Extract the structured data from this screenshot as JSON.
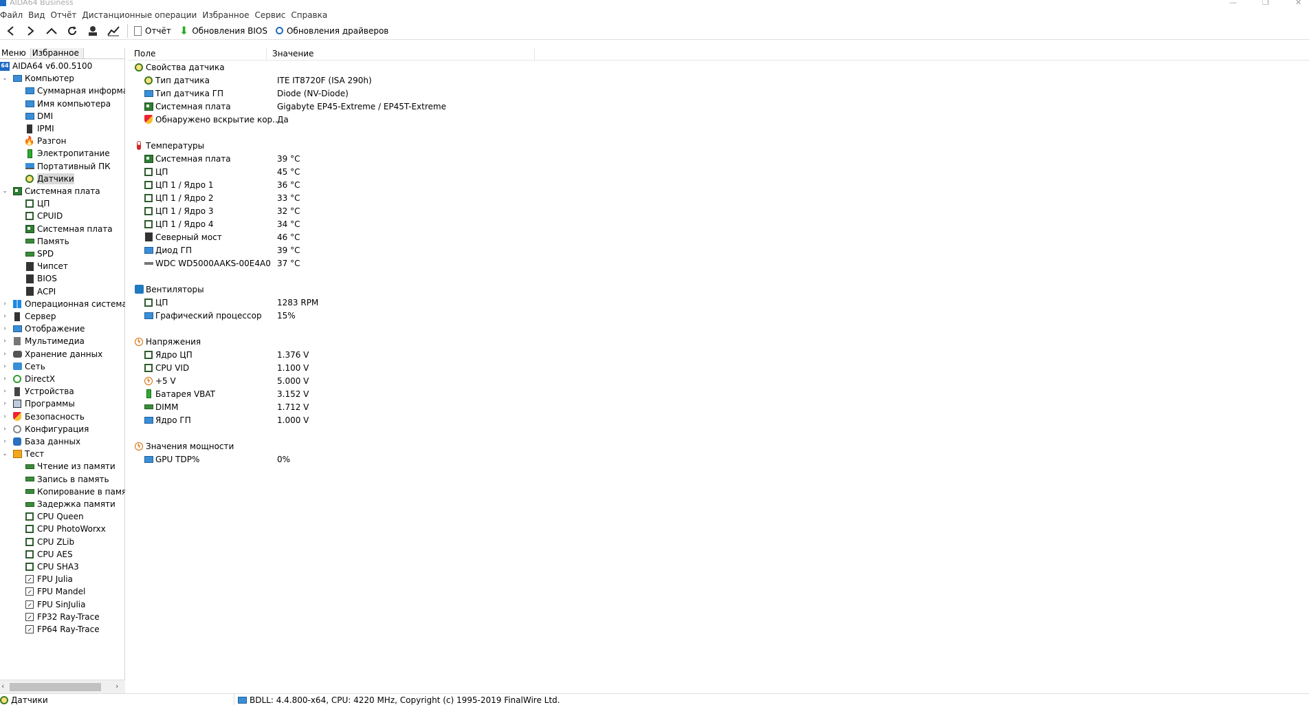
{
  "window": {
    "title": "AIDA64 Business"
  },
  "menu": [
    "Файл",
    "Вид",
    "Отчёт",
    "Дистанционные операции",
    "Избранное",
    "Сервис",
    "Справка"
  ],
  "toolbar": {
    "report": "Отчёт",
    "bios_updates": "Обновления BIOS",
    "driver_updates": "Обновления драйверов"
  },
  "left_tabs": {
    "menu": "Меню",
    "favorites": "Избранное"
  },
  "tree": [
    {
      "label": "AIDA64 v6.00.5100",
      "icon": "aida64-icon",
      "level": 0,
      "exp": ""
    },
    {
      "label": "Компьютер",
      "icon": "monitor-icon",
      "level": 1,
      "exp": "v"
    },
    {
      "label": "Суммарная информация",
      "icon": "monitor-icon",
      "level": 2,
      "exp": ""
    },
    {
      "label": "Имя компьютера",
      "icon": "monitor-icon",
      "level": 2,
      "exp": ""
    },
    {
      "label": "DMI",
      "icon": "monitor-icon",
      "level": 2,
      "exp": ""
    },
    {
      "label": "IPMI",
      "icon": "server-icon",
      "level": 2,
      "exp": ""
    },
    {
      "label": "Разгон",
      "icon": "flame-icon",
      "level": 2,
      "exp": ""
    },
    {
      "label": "Электропитание",
      "icon": "battery-icon",
      "level": 2,
      "exp": ""
    },
    {
      "label": "Портативный ПК",
      "icon": "laptop-icon",
      "level": 2,
      "exp": ""
    },
    {
      "label": "Датчики",
      "icon": "sensor-icon",
      "level": 2,
      "exp": "",
      "selected": true
    },
    {
      "label": "Системная плата",
      "icon": "motherboard-icon",
      "level": 1,
      "exp": "v"
    },
    {
      "label": "ЦП",
      "icon": "chip-icon",
      "level": 2,
      "exp": ""
    },
    {
      "label": "CPUID",
      "icon": "chip-icon",
      "level": 2,
      "exp": ""
    },
    {
      "label": "Системная плата",
      "icon": "motherboard-icon",
      "level": 2,
      "exp": ""
    },
    {
      "label": "Память",
      "icon": "ram-icon",
      "level": 2,
      "exp": ""
    },
    {
      "label": "SPD",
      "icon": "ram-icon",
      "level": 2,
      "exp": ""
    },
    {
      "label": "Чипсет",
      "icon": "chipset-icon",
      "level": 2,
      "exp": ""
    },
    {
      "label": "BIOS",
      "icon": "chipset-icon",
      "level": 2,
      "exp": ""
    },
    {
      "label": "ACPI",
      "icon": "chipset-icon",
      "level": 2,
      "exp": ""
    },
    {
      "label": "Операционная система",
      "icon": "windows-icon",
      "level": 1,
      "exp": ">"
    },
    {
      "label": "Сервер",
      "icon": "server-icon",
      "level": 1,
      "exp": ">"
    },
    {
      "label": "Отображение",
      "icon": "monitor-icon",
      "level": 1,
      "exp": ">"
    },
    {
      "label": "Мультимедиа",
      "icon": "speaker-icon",
      "level": 1,
      "exp": ">"
    },
    {
      "label": "Хранение данных",
      "icon": "storage-icon",
      "level": 1,
      "exp": ">"
    },
    {
      "label": "Сеть",
      "icon": "network-icon",
      "level": 1,
      "exp": ">"
    },
    {
      "label": "DirectX",
      "icon": "xbox-icon",
      "level": 1,
      "exp": ">"
    },
    {
      "label": "Устройства",
      "icon": "device-icon",
      "level": 1,
      "exp": ">"
    },
    {
      "label": "Программы",
      "icon": "program-icon",
      "level": 1,
      "exp": ">"
    },
    {
      "label": "Безопасность",
      "icon": "shield-icon",
      "level": 1,
      "exp": ">"
    },
    {
      "label": "Конфигурация",
      "icon": "gear-icon",
      "level": 1,
      "exp": ">"
    },
    {
      "label": "База данных",
      "icon": "database-icon",
      "level": 1,
      "exp": ">"
    },
    {
      "label": "Тест",
      "icon": "test-icon",
      "level": 1,
      "exp": "v"
    },
    {
      "label": "Чтение из памяти",
      "icon": "ram-icon",
      "level": 2,
      "exp": ""
    },
    {
      "label": "Запись в память",
      "icon": "ram-icon",
      "level": 2,
      "exp": ""
    },
    {
      "label": "Копирование в памяти",
      "icon": "ram-icon",
      "level": 2,
      "exp": ""
    },
    {
      "label": "Задержка памяти",
      "icon": "ram-icon",
      "level": 2,
      "exp": ""
    },
    {
      "label": "CPU Queen",
      "icon": "chip-icon",
      "level": 2,
      "exp": ""
    },
    {
      "label": "CPU PhotoWorxx",
      "icon": "chip-icon",
      "level": 2,
      "exp": ""
    },
    {
      "label": "CPU ZLib",
      "icon": "chip-icon",
      "level": 2,
      "exp": ""
    },
    {
      "label": "CPU AES",
      "icon": "chip-icon",
      "level": 2,
      "exp": ""
    },
    {
      "label": "CPU SHA3",
      "icon": "chip-icon",
      "level": 2,
      "exp": ""
    },
    {
      "label": "FPU Julia",
      "icon": "fpu-icon",
      "level": 2,
      "exp": ""
    },
    {
      "label": "FPU Mandel",
      "icon": "fpu-icon",
      "level": 2,
      "exp": ""
    },
    {
      "label": "FPU SinJulia",
      "icon": "fpu-icon",
      "level": 2,
      "exp": ""
    },
    {
      "label": "FP32 Ray-Trace",
      "icon": "fpu-icon",
      "level": 2,
      "exp": ""
    },
    {
      "label": "FP64 Ray-Trace",
      "icon": "fpu-icon",
      "level": 2,
      "exp": ""
    }
  ],
  "columns": {
    "field": "Поле",
    "value": "Значение"
  },
  "sections": [
    {
      "title": "Свойства датчика",
      "icon": "sensor-icon",
      "items": [
        {
          "field": "Тип датчика",
          "value": "ITE IT8720F  (ISA 290h)",
          "icon": "sensor-icon"
        },
        {
          "field": "Тип датчика ГП",
          "value": "Diode  (NV-Diode)",
          "icon": "monitor-icon"
        },
        {
          "field": "Системная плата",
          "value": "Gigabyte EP45-Extreme / EP45T-Extreme",
          "icon": "motherboard-icon"
        },
        {
          "field": "Обнаружено вскрытие кор...",
          "value": "Да",
          "icon": "shield-icon"
        }
      ]
    },
    {
      "title": "Температуры",
      "icon": "thermometer-icon",
      "items": [
        {
          "field": "Системная плата",
          "value": "39 °C",
          "icon": "motherboard-icon"
        },
        {
          "field": "ЦП",
          "value": "45 °C",
          "icon": "chip-icon"
        },
        {
          "field": "ЦП 1 / Ядро 1",
          "value": "36 °C",
          "icon": "chip-icon"
        },
        {
          "field": "ЦП 1 / Ядро 2",
          "value": "33 °C",
          "icon": "chip-icon"
        },
        {
          "field": "ЦП 1 / Ядро 3",
          "value": "32 °C",
          "icon": "chip-icon"
        },
        {
          "field": "ЦП 1 / Ядро 4",
          "value": "34 °C",
          "icon": "chip-icon"
        },
        {
          "field": "Северный мост",
          "value": "46 °C",
          "icon": "chipset-icon"
        },
        {
          "field": "Диод ГП",
          "value": "39 °C",
          "icon": "monitor-icon"
        },
        {
          "field": "WDC WD5000AAKS-00E4A0",
          "value": "37 °C",
          "icon": "disk-icon"
        }
      ]
    },
    {
      "title": "Вентиляторы",
      "icon": "fan-icon",
      "items": [
        {
          "field": "ЦП",
          "value": "1283 RPM",
          "icon": "chip-icon"
        },
        {
          "field": "Графический процессор",
          "value": "15%",
          "icon": "monitor-icon"
        }
      ]
    },
    {
      "title": "Напряжения",
      "icon": "voltage-icon",
      "items": [
        {
          "field": "Ядро ЦП",
          "value": "1.376 V",
          "icon": "chip-icon"
        },
        {
          "field": "CPU VID",
          "value": "1.100 V",
          "icon": "chip-icon"
        },
        {
          "field": "+5 V",
          "value": "5.000 V",
          "icon": "voltage-icon"
        },
        {
          "field": "Батарея VBAT",
          "value": "3.152 V",
          "icon": "battery-icon"
        },
        {
          "field": "DIMM",
          "value": "1.712 V",
          "icon": "ram-icon"
        },
        {
          "field": "Ядро ГП",
          "value": "1.000 V",
          "icon": "monitor-icon"
        }
      ]
    },
    {
      "title": "Значения мощности",
      "icon": "voltage-icon",
      "items": [
        {
          "field": "GPU TDP%",
          "value": "0%",
          "icon": "monitor-icon"
        }
      ]
    }
  ],
  "statusbar": {
    "left": "Датчики",
    "right": "BDLL: 4.4.800-x64, CPU: 4220 MHz, Copyright (c) 1995-2019 FinalWire Ltd."
  }
}
